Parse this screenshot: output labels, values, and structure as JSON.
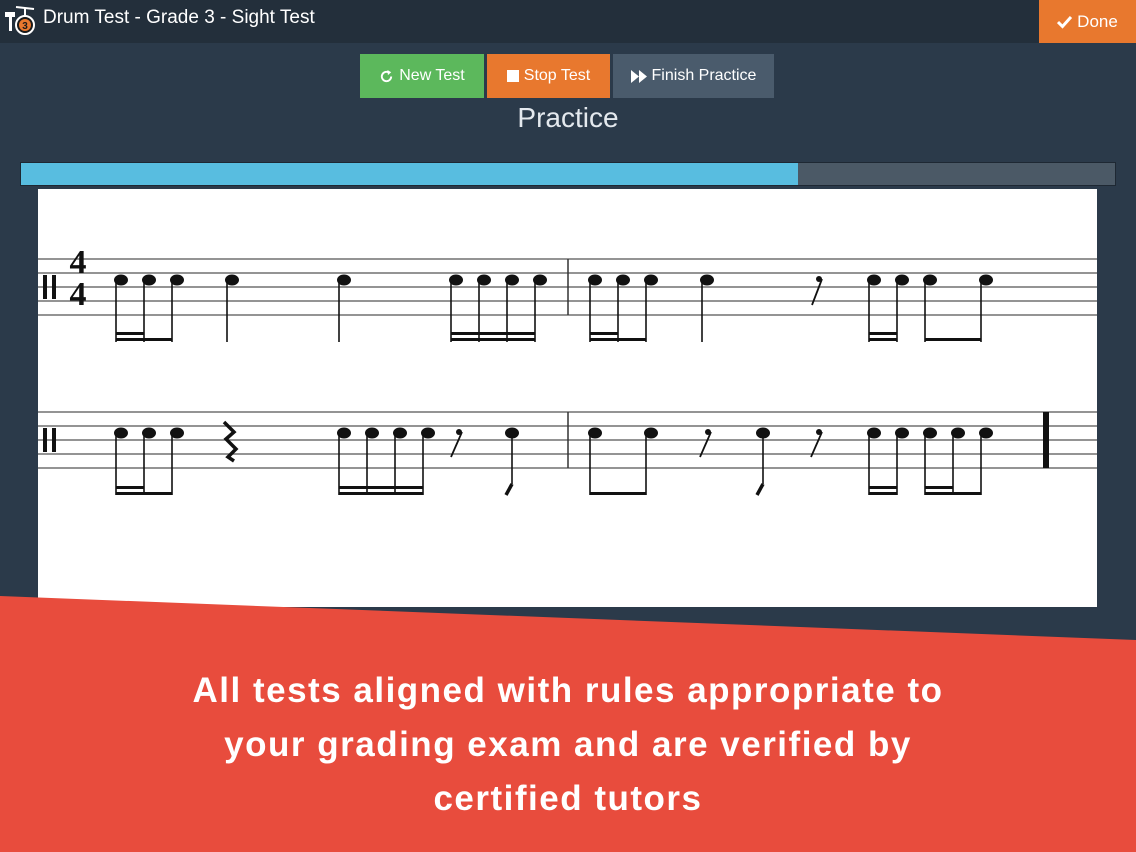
{
  "header": {
    "title": "Drum Test - Grade 3 -  Sight Test",
    "done_label": "Done",
    "app_icon_badge": "3"
  },
  "toolbar": {
    "new_test_label": "New Test",
    "stop_test_label": "Stop Test",
    "finish_practice_label": "Finish Practice"
  },
  "mode": {
    "label": "Practice"
  },
  "progress": {
    "percent": 71
  },
  "score": {
    "time_signature": {
      "top": "4",
      "bottom": "4"
    }
  },
  "promo": {
    "lines": [
      "All tests aligned with rules appropriate to",
      "your grading exam and are verified by",
      "certified tutors"
    ]
  },
  "colors": {
    "topbar": "#232f3b",
    "background": "#2b3a4a",
    "new_test": "#5cb85c",
    "stop_test": "#e8782e",
    "finish": "#4a5b6c",
    "done": "#e8782e",
    "progress_fill": "#58bde0",
    "promo": "#e84c3d"
  }
}
